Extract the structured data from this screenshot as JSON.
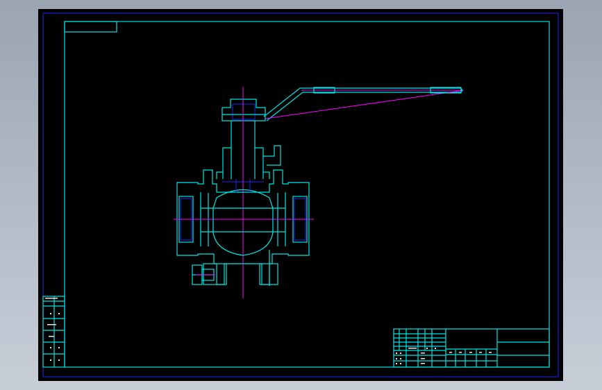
{
  "drawing": {
    "line_colors": {
      "outline": "#00e5e5",
      "frame": "#2222ff",
      "centerline": "#ff00ff"
    },
    "background": "#000000"
  }
}
